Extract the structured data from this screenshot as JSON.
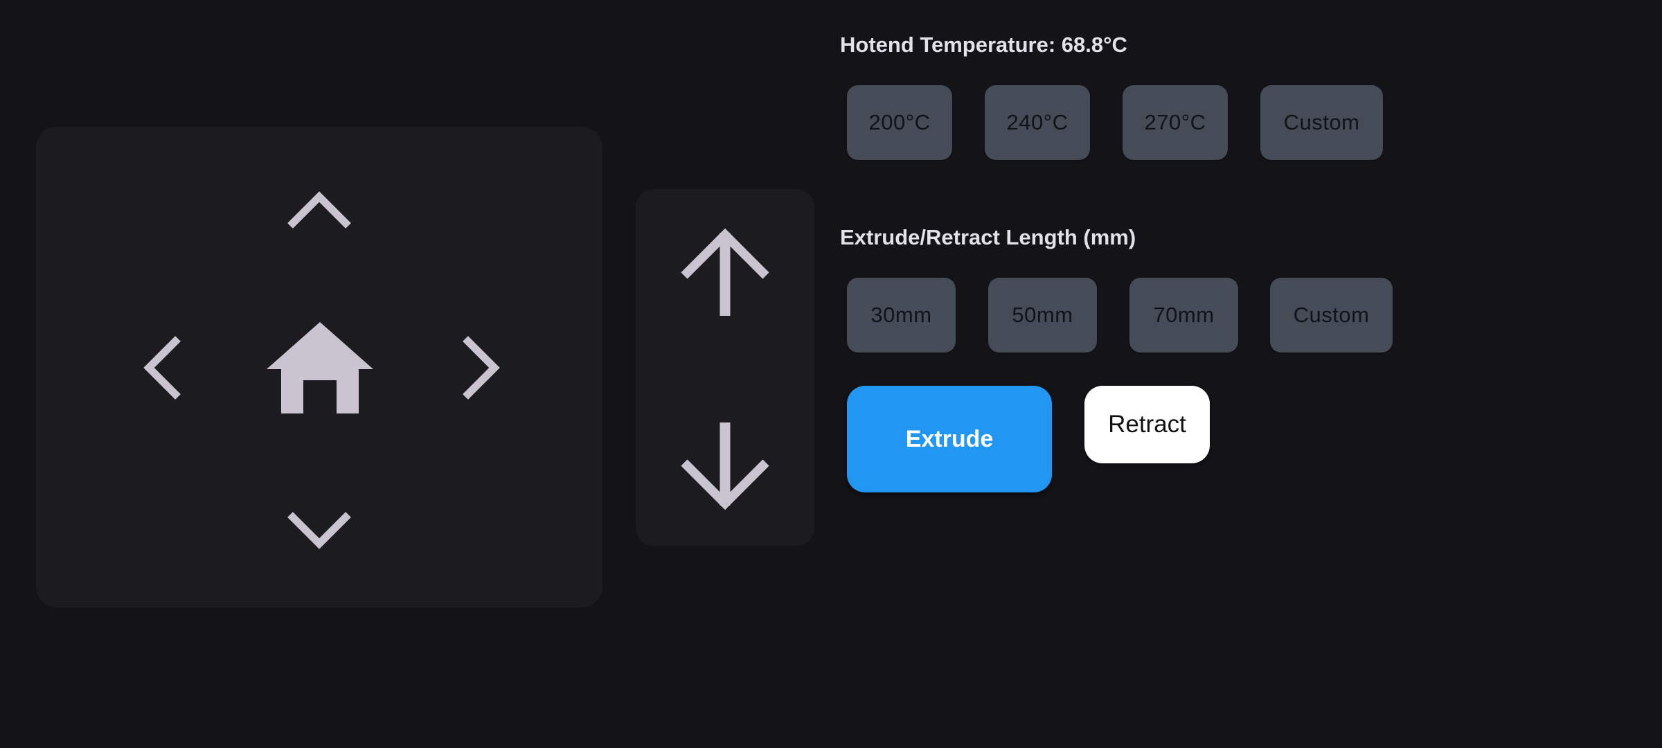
{
  "temperature": {
    "label": "Hotend Temperature: ",
    "value": "68.8°C",
    "presets": [
      "200°C",
      "240°C",
      "270°C",
      "Custom"
    ]
  },
  "extrusion": {
    "label": "Extrude/Retract Length (mm)",
    "presets": [
      "30mm",
      "50mm",
      "70mm",
      "Custom"
    ],
    "extrude_label": "Extrude",
    "retract_label": "Retract"
  },
  "icons": {
    "xy_up": "chevron-up-icon",
    "xy_down": "chevron-down-icon",
    "xy_left": "chevron-left-icon",
    "xy_right": "chevron-right-icon",
    "home": "home-icon",
    "z_up": "arrow-up-icon",
    "z_down": "arrow-down-icon"
  },
  "colors": {
    "background": "#141318",
    "panel": "#1c1b20",
    "icon": "#c9c4d0",
    "chip": "#454b57",
    "accent": "#2196f3"
  }
}
